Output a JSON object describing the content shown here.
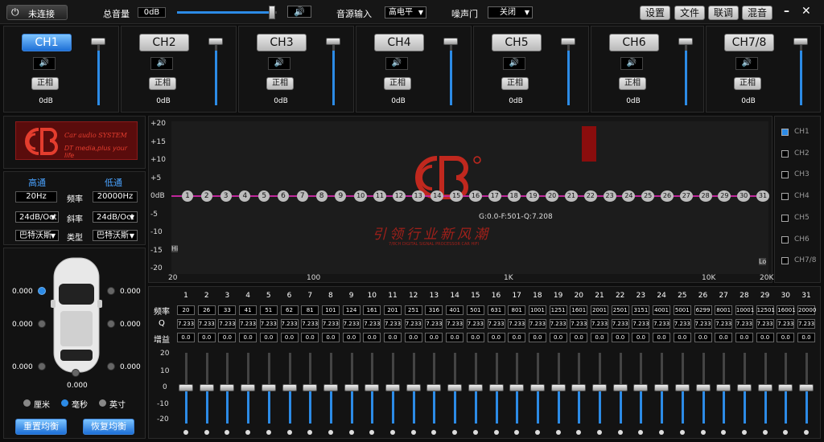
{
  "topbar": {
    "connect_label": "未连接",
    "volume_label": "总音量",
    "volume_value": "0dB",
    "volume_fraction": 0.95,
    "source_label": "音源输入",
    "source_value": "高电平",
    "noise_label": "噪声门",
    "noise_value": "关闭",
    "settings_label": "设置",
    "file_label": "文件",
    "link_label": "联调",
    "mix_label": "混音",
    "minimize_label": "–",
    "close_label": "✕"
  },
  "channels": [
    {
      "label": "CH1",
      "phase": "正相",
      "db": "0dB",
      "active": true,
      "level": 0.85
    },
    {
      "label": "CH2",
      "phase": "正相",
      "db": "0dB",
      "active": false,
      "level": 0.85
    },
    {
      "label": "CH3",
      "phase": "正相",
      "db": "0dB",
      "active": false,
      "level": 0.85
    },
    {
      "label": "CH4",
      "phase": "正相",
      "db": "0dB",
      "active": false,
      "level": 0.85
    },
    {
      "label": "CH5",
      "phase": "正相",
      "db": "0dB",
      "active": false,
      "level": 0.85
    },
    {
      "label": "CH6",
      "phase": "正相",
      "db": "0dB",
      "active": false,
      "level": 0.85
    },
    {
      "label": "CH7/8",
      "phase": "正相",
      "db": "0dB",
      "active": false,
      "level": 0.85
    }
  ],
  "logo": {
    "line1": "Car audio SYSTEM",
    "line2": "DT media,plus your life"
  },
  "crossover": {
    "highpass_label": "高通",
    "lowpass_label": "低通",
    "freq_label": "频率",
    "slope_label": "斜率",
    "type_label": "类型",
    "hp_freq": "20Hz",
    "lp_freq": "20000Hz",
    "hp_slope": "24dB/Oct",
    "lp_slope": "24dB/Oct",
    "hp_type": "巴特沃斯",
    "lp_type": "巴特沃斯"
  },
  "graph": {
    "y_ticks": [
      "+20",
      "+15",
      "+10",
      "+5",
      "0dB",
      "-5",
      "-10",
      "-15",
      "-20"
    ],
    "x_ticks": [
      "20",
      "100",
      "1K",
      "10K",
      "20K"
    ],
    "readout": "G:0.0-F:501-Q:7.208",
    "watermark_slogan": "引领行业新风潮",
    "watermark_sub": "7/8CH DIGITAL SIGNAL PROCESSOR CAR HIFI",
    "edge_left": "Hi",
    "edge_right": "Lo",
    "nodes": [
      "1",
      "2",
      "3",
      "4",
      "5",
      "6",
      "7",
      "8",
      "9",
      "10",
      "11",
      "12",
      "13",
      "14",
      "15",
      "16",
      "17",
      "18",
      "19",
      "20",
      "21",
      "22",
      "23",
      "24",
      "25",
      "26",
      "27",
      "28",
      "29",
      "30",
      "31"
    ]
  },
  "channel_list": [
    {
      "label": "CH1",
      "checked": true
    },
    {
      "label": "CH2",
      "checked": false
    },
    {
      "label": "CH3",
      "checked": false
    },
    {
      "label": "CH4",
      "checked": false
    },
    {
      "label": "CH5",
      "checked": false
    },
    {
      "label": "CH6",
      "checked": false
    },
    {
      "label": "CH7/8",
      "checked": false
    }
  ],
  "delay": {
    "values": [
      "0.000",
      "0.000",
      "0.000",
      "0.000",
      "0.000",
      "0.000",
      "0.000"
    ],
    "unit_cm": "厘米",
    "unit_ms": "毫秒",
    "unit_inch": "英寸",
    "reset_label": "重置均衡",
    "restore_label": "恢复均衡"
  },
  "eq": {
    "freq_label": "频率",
    "q_label": "Q",
    "gain_label": "增益",
    "scale": [
      "20",
      "10",
      "0",
      "-10",
      "-20"
    ],
    "bands": [
      "1",
      "2",
      "3",
      "4",
      "5",
      "6",
      "7",
      "8",
      "9",
      "10",
      "11",
      "12",
      "13",
      "14",
      "15",
      "16",
      "17",
      "18",
      "19",
      "20",
      "21",
      "22",
      "23",
      "24",
      "25",
      "26",
      "27",
      "28",
      "29",
      "30",
      "31"
    ],
    "freqs": [
      "20",
      "26",
      "33",
      "41",
      "51",
      "62",
      "81",
      "101",
      "124",
      "161",
      "201",
      "251",
      "316",
      "401",
      "501",
      "631",
      "801",
      "1001",
      "1251",
      "1601",
      "2001",
      "2501",
      "3151",
      "4001",
      "5001",
      "6299",
      "8001",
      "10001",
      "12501",
      "16001",
      "20000"
    ],
    "q": [
      "7.233",
      "7.233",
      "7.233",
      "7.233",
      "7.233",
      "7.233",
      "7.233",
      "7.233",
      "7.233",
      "7.233",
      "7.233",
      "7.233",
      "7.233",
      "7.233",
      "7.233",
      "7.233",
      "7.233",
      "7.233",
      "7.233",
      "7.233",
      "7.233",
      "7.233",
      "7.233",
      "7.233",
      "7.233",
      "7.233",
      "7.233",
      "7.233",
      "7.233",
      "7.233",
      "7.233"
    ],
    "gain": [
      "0.0",
      "0.0",
      "0.0",
      "0.0",
      "0.0",
      "0.0",
      "0.0",
      "0.0",
      "0.0",
      "0.0",
      "0.0",
      "0.0",
      "0.0",
      "0.0",
      "0.0",
      "0.0",
      "0.0",
      "0.0",
      "0.0",
      "0.0",
      "0.0",
      "0.0",
      "0.0",
      "0.0",
      "0.0",
      "0.0",
      "0.0",
      "0.0",
      "0.0",
      "0.0",
      "0.0"
    ]
  }
}
